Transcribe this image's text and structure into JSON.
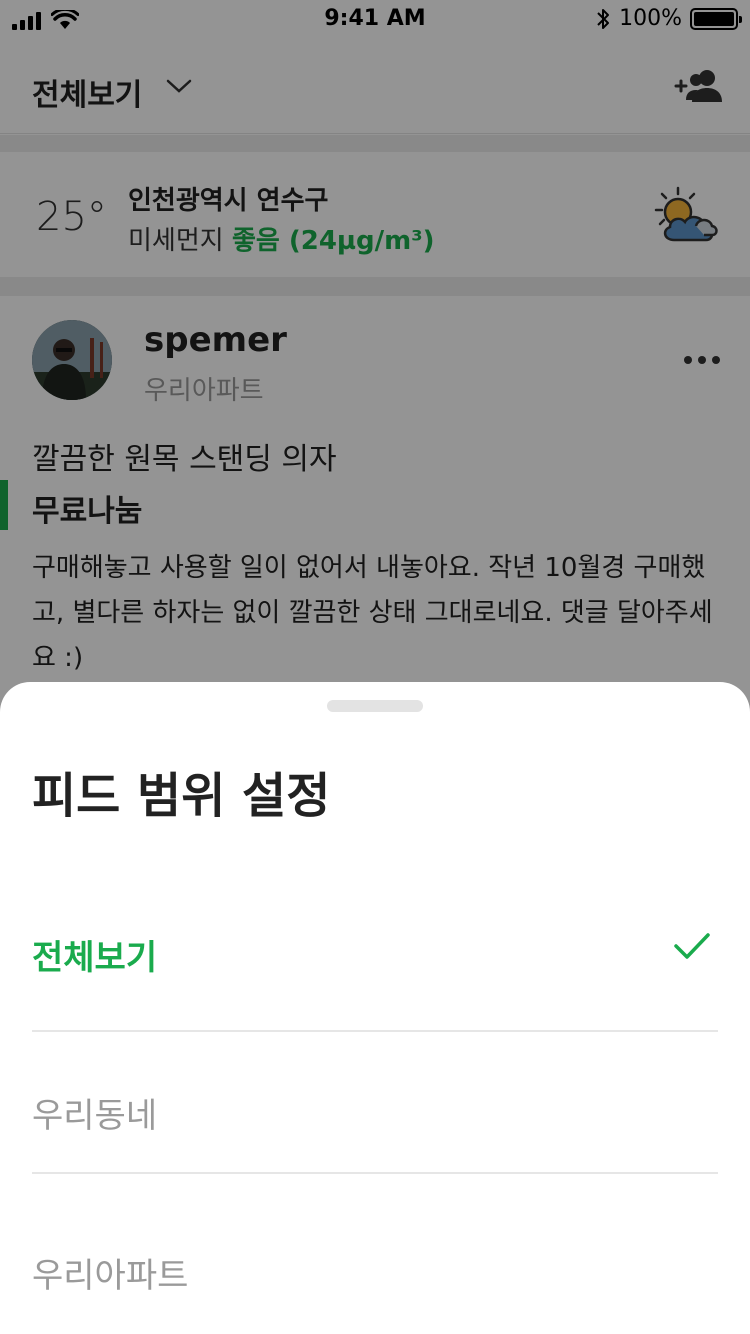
{
  "status_bar": {
    "time": "9:41 AM",
    "battery_percent": "100%",
    "icons": [
      "signal-icon",
      "wifi-icon",
      "bluetooth-icon",
      "battery-icon"
    ]
  },
  "header": {
    "title": "전체보기",
    "icons": [
      "chevron-down-icon",
      "add-friend-icon"
    ]
  },
  "weather": {
    "temperature": "25°",
    "location": "인천광역시 연수구",
    "dust_label": "미세먼지",
    "dust_status": "좋음 (24µg/m³)",
    "icon": "partly-cloudy-icon"
  },
  "post": {
    "username": "spemer",
    "community": "우리아파트",
    "title": "깔끔한 원목 스탠딩 의자",
    "category": "무료나눔",
    "body": "구매해놓고 사용할 일이 없어서 내놓아요. 작년 10월경 구매했고, 별다른 하자는 없이 깔끔한 상태 그대로네요. 댓글 달아주세요 :)"
  },
  "sheet": {
    "title": "피드 범위 설정",
    "options": [
      {
        "label": "전체보기",
        "selected": true
      },
      {
        "label": "우리동네",
        "selected": false
      },
      {
        "label": "우리아파트",
        "selected": false
      }
    ]
  },
  "colors": {
    "accent": "#1aab4d",
    "overlay": "rgba(0,0,0,0.42)"
  }
}
